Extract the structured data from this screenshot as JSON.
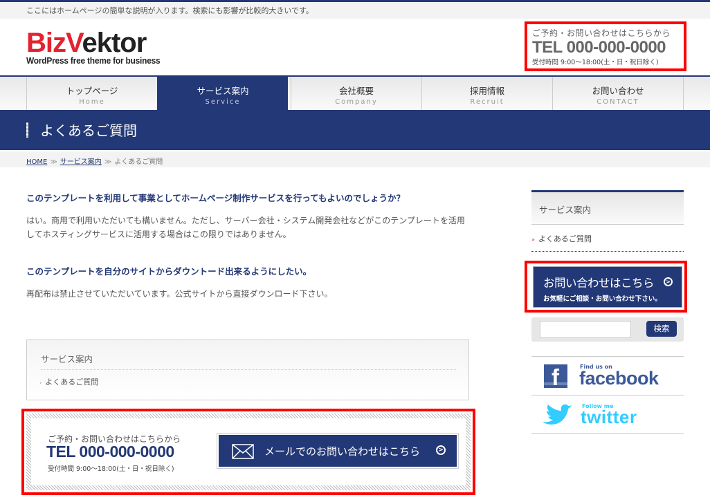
{
  "site": {
    "description": "ここにはホームページの簡単な説明が入ります。検索にも影響が比較的大きいです。",
    "logo": {
      "part1": "Biz",
      "part2": "V",
      "part3": "ektor",
      "tagline": "WordPress free theme for business"
    },
    "brand_color": "#233876",
    "accent_color": "#e3232f"
  },
  "header_contact": {
    "lead": "ご予約・お問い合わせはこちらから",
    "tel": "TEL 000-000-0000",
    "hours": "受付時間 9:00〜18:00(土・日・祝日除く)"
  },
  "nav": {
    "items": [
      {
        "jp": "トップページ",
        "en": "Home",
        "active": false
      },
      {
        "jp": "サービス案内",
        "en": "Service",
        "active": true
      },
      {
        "jp": "会社概要",
        "en": "Company",
        "active": false
      },
      {
        "jp": "採用情報",
        "en": "Recruit",
        "active": false
      },
      {
        "jp": "お問い合わせ",
        "en": "CONTACT",
        "active": false
      }
    ]
  },
  "page": {
    "title": "よくあるご質問",
    "breadcrumb": [
      {
        "label": "HOME",
        "link": true
      },
      {
        "label": "サービス案内",
        "link": true
      },
      {
        "label": "よくあるご質問",
        "link": false
      }
    ],
    "separator": "≫"
  },
  "faq": [
    {
      "q": "このテンプレートを利用して事業としてホームページ制作サービスを行ってもよいのでしょうか？",
      "a": "はい。商用で利用いただいても構いません。ただし、サーバー会社・システム開発会社などがこのテンプレートを活用してホスティングサービスに活用する場合はこの限りではありません。"
    },
    {
      "q": "このテンプレートを自分のサイトからダウントード出来るようにしたい。",
      "a": "再配布は禁止させていただいています。公式サイトから直接ダウンロード下さい。"
    }
  ],
  "sub_menu": {
    "title": "サービス案内",
    "items": [
      "よくあるご質問"
    ]
  },
  "contact_box": {
    "lead": "ご予約・お問い合わせはこちらから",
    "tel": "TEL 000-000-0000",
    "hours": "受付時間 9:00〜18:00(土・日・祝日除く)",
    "mail_button": "メールでのお問い合わせはこちら"
  },
  "sidebar": {
    "menu_title": "サービス案内",
    "menu_items": [
      "よくあるご質問"
    ],
    "cta_main": "お問い合わせはこちら",
    "cta_sub": "お気軽にご相談・お問い合わせ下さい。",
    "search_placeholder": "",
    "search_button": "検索",
    "facebook": {
      "small": "Find us on",
      "word": "facebook"
    },
    "twitter": {
      "small": "Follow me",
      "word": "twitter"
    }
  }
}
